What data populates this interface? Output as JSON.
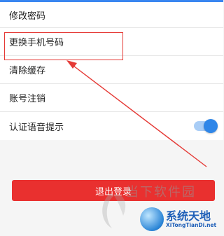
{
  "settings": {
    "items": [
      {
        "label": "修改密码"
      },
      {
        "label": "更换手机号码"
      },
      {
        "label": "清除缓存"
      },
      {
        "label": "账号注销"
      },
      {
        "label": "认证语音提示",
        "toggle_on": true
      }
    ]
  },
  "logout": {
    "label": "退出登录"
  },
  "watermark": {
    "text_top": "当下软件园",
    "text_brand": "系统天地",
    "text_url": "XiTongTianDi.net"
  },
  "colors": {
    "accent": "#2f86e8",
    "logout_bg": "#e9302f",
    "highlight": "#e53935"
  }
}
